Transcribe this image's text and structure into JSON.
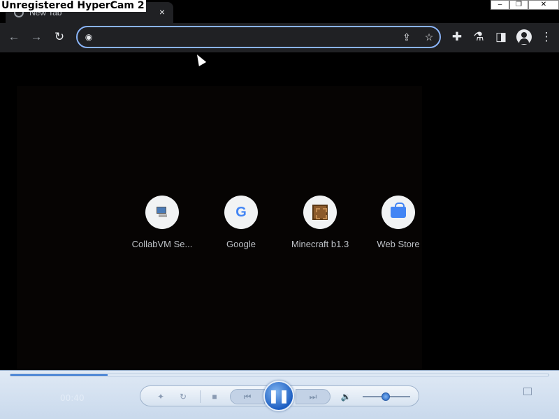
{
  "watermark": "Unregistered HyperCam 2",
  "tab": {
    "title": "New Tab",
    "close_glyph": "×"
  },
  "window_controls": {
    "minimize": "–",
    "restore": "❐",
    "close": "✕"
  },
  "toolbar": {
    "back_glyph": "←",
    "forward_glyph": "→",
    "reload_glyph": "↻",
    "omnibox_value": "",
    "omnibox_placeholder": "",
    "share_glyph": "⇪",
    "bookmark_glyph": "☆",
    "extensions_glyph": "✚",
    "labs_glyph": "⚗",
    "side_panel_glyph": "◨",
    "menu_glyph": "⋮"
  },
  "shortcuts": [
    {
      "label": "CollabVM Se...",
      "icon": "collabvm-icon"
    },
    {
      "label": "Google",
      "icon": "google-icon",
      "glyph": "G"
    },
    {
      "label": "Minecraft b1.3",
      "icon": "minecraft-icon"
    },
    {
      "label": "Web Store",
      "icon": "web-store-icon"
    }
  ],
  "player": {
    "elapsed": "00:40",
    "seek_progress": 0.18,
    "volume_level": 0.48,
    "shuffle_glyph": "✦",
    "repeat_glyph": "↻",
    "stop_glyph": "■",
    "prev_glyph": "⏮",
    "play_pause_glyph": "❚❚",
    "next_glyph": "⏭",
    "mute_glyph": "🔉"
  },
  "colors": {
    "omnibox_focus": "#8ab4f8",
    "toolbar_bg": "#202124",
    "player_accent": "#1e5fc2"
  }
}
